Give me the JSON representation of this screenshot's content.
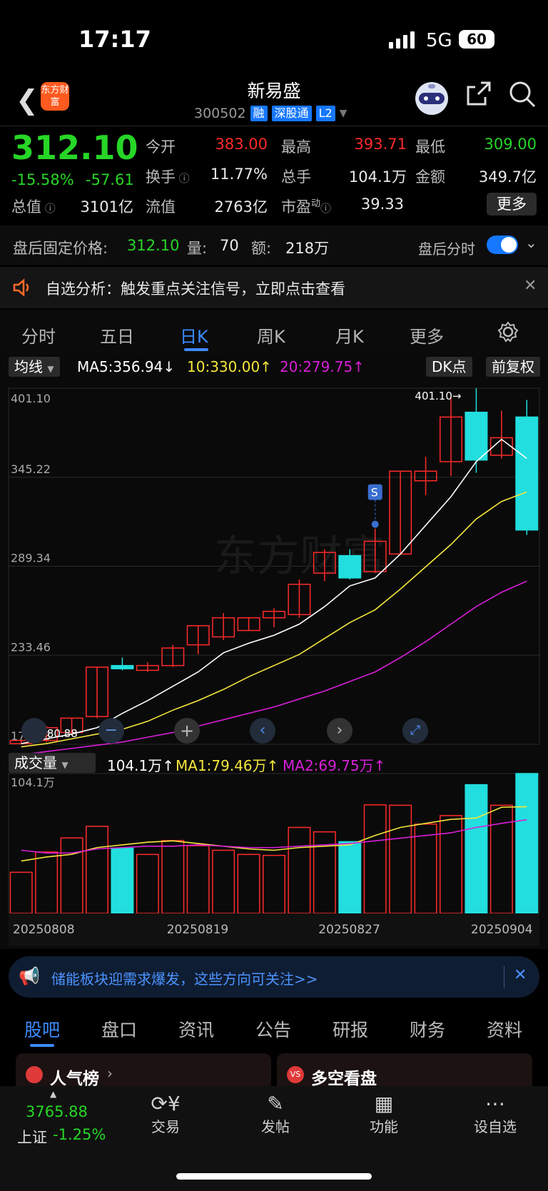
{
  "status_bar": {
    "time": "17:17",
    "network": "5G",
    "battery": "60"
  },
  "header": {
    "stock_name": "新易盛",
    "stock_code": "300502",
    "tags": [
      "融",
      "深股通",
      "L2"
    ],
    "logo_text": "东方财富"
  },
  "quote": {
    "price": "312.10",
    "change_pct": "-15.58%",
    "change_amt": "-57.61",
    "fields": [
      {
        "label": "今开",
        "value": "383.00"
      },
      {
        "label": "最高",
        "value": "393.71"
      },
      {
        "label": "最低",
        "value": "309.00"
      },
      {
        "label": "换手",
        "value": "11.77%"
      },
      {
        "label": "总手",
        "value": "104.1万"
      },
      {
        "label": "金额",
        "value": "349.7亿"
      },
      {
        "label": "总值",
        "value": "3101亿"
      },
      {
        "label": "流值",
        "value": "2763亿"
      },
      {
        "label": "市盈",
        "value": "39.33"
      }
    ],
    "pe_superscript": "动",
    "more_button": "更多"
  },
  "after_hours": {
    "label": "盘后固定价格:",
    "price": "312.10",
    "vol_label": "量:",
    "vol": "70",
    "amt_label": "额:",
    "amt": "218万",
    "toggle_label": "盘后分时"
  },
  "notice": {
    "text": "自选分析：触发重点关注信号，立即点击查看"
  },
  "chart_tabs": [
    "分时",
    "五日",
    "日K",
    "周K",
    "月K",
    "更多"
  ],
  "ma_bar": {
    "selector": "均线",
    "ma5": "MA5:356.94",
    "ma10": "10:330.00",
    "ma20": "20:279.75",
    "dk_button": "DK点",
    "adjust_button": "前复权"
  },
  "volume_bar": {
    "selector": "成交量",
    "vol": "104.1万",
    "ma1": "MA1:79.46万",
    "ma2": "MA2:69.75万",
    "top_label": "104.1万"
  },
  "colors": {
    "up": "#ff2a2a",
    "down": "#22dede",
    "ma5": "#ffffff",
    "ma10": "#f5e63c",
    "ma20": "#d81ed8"
  },
  "chart_data": {
    "type": "candlestick",
    "y_axis_labels": [
      "401.10",
      "345.22",
      "289.34",
      "233.46",
      "177.58"
    ],
    "ylim": [
      177.58,
      401.1
    ],
    "high_marker": "401.10",
    "low_marker": "180.88",
    "signal_marker": "S",
    "x_labels": [
      "20250808",
      "20250819",
      "20250827",
      "20250904"
    ],
    "candles": [
      {
        "o": 178,
        "h": 180,
        "c": 180,
        "l": 177.6
      },
      {
        "o": 180,
        "h": 189,
        "c": 188,
        "l": 179
      },
      {
        "o": 185,
        "h": 194,
        "c": 194,
        "l": 184
      },
      {
        "o": 195,
        "h": 226,
        "c": 226,
        "l": 194
      },
      {
        "o": 227,
        "h": 232,
        "c": 225,
        "l": 224
      },
      {
        "o": 224,
        "h": 229,
        "c": 227,
        "l": 223
      },
      {
        "o": 227,
        "h": 240,
        "c": 238,
        "l": 226
      },
      {
        "o": 240,
        "h": 252,
        "c": 252,
        "l": 234
      },
      {
        "o": 245,
        "h": 260,
        "c": 257,
        "l": 243
      },
      {
        "o": 249,
        "h": 257,
        "c": 257,
        "l": 249
      },
      {
        "o": 257,
        "h": 263,
        "c": 261,
        "l": 251
      },
      {
        "o": 259,
        "h": 281,
        "c": 278,
        "l": 257
      },
      {
        "o": 285,
        "h": 300,
        "c": 298,
        "l": 280
      },
      {
        "o": 296,
        "h": 300,
        "c": 282,
        "l": 281
      },
      {
        "o": 286,
        "h": 313,
        "c": 305,
        "l": 285
      },
      {
        "o": 297,
        "h": 349,
        "c": 349,
        "l": 297
      },
      {
        "o": 343,
        "h": 358,
        "c": 349,
        "l": 334
      },
      {
        "o": 355,
        "h": 395,
        "c": 383,
        "l": 346
      },
      {
        "o": 386,
        "h": 401.1,
        "c": 356,
        "l": 348
      },
      {
        "o": 359,
        "h": 387,
        "c": 370,
        "l": 357
      },
      {
        "o": 383,
        "h": 393.71,
        "c": 312.1,
        "l": 309
      }
    ],
    "ma5": [
      178,
      181,
      184,
      188,
      197,
      205,
      214,
      223,
      235,
      241,
      246,
      253,
      264,
      277,
      282,
      297,
      315,
      333,
      355,
      369,
      357
    ],
    "ma10": [
      176,
      178,
      181,
      184,
      187,
      192,
      199,
      205,
      212,
      220,
      227,
      234,
      244,
      254,
      262,
      275,
      289,
      303,
      319,
      330,
      336
    ],
    "ma20": [
      171,
      173,
      175,
      177,
      179,
      182,
      185,
      189,
      193,
      197,
      201,
      206,
      211,
      217,
      223,
      232,
      242,
      253,
      264,
      273,
      280
    ],
    "volumes": [
      30.6,
      45.7,
      56.2,
      64.8,
      48.6,
      43.9,
      54.2,
      50.4,
      47.0,
      43.9,
      43.2,
      64.0,
      60.7,
      53.4,
      80.8,
      80.5,
      66.5,
      72.8,
      95.8,
      80.5,
      104.1
    ],
    "volume_ma1": [
      39,
      42,
      44,
      49,
      51,
      53,
      54,
      52,
      50,
      48,
      47,
      49,
      50,
      51,
      58,
      64,
      67,
      70,
      71,
      79,
      79.46
    ],
    "volume_ma2": [
      47,
      45,
      45,
      48,
      49,
      50,
      50,
      51,
      50,
      49,
      49,
      50,
      51,
      52,
      54,
      56,
      58,
      60,
      64,
      67,
      69.75
    ]
  },
  "banner": {
    "text": "储能板块迎需求爆发，这些方向可关注>>"
  },
  "bottom_tabs": [
    "股吧",
    "盘口",
    "资讯",
    "公告",
    "研报",
    "财务",
    "资料"
  ],
  "cards": [
    {
      "label": "人气榜"
    },
    {
      "label": "多空看盘"
    }
  ],
  "dock": {
    "index_value": "3765.88",
    "index_name": "上证",
    "index_change": "-1.25%",
    "items": [
      {
        "label": "交易"
      },
      {
        "label": "发帖"
      },
      {
        "label": "功能"
      },
      {
        "label": "设自选"
      }
    ]
  }
}
